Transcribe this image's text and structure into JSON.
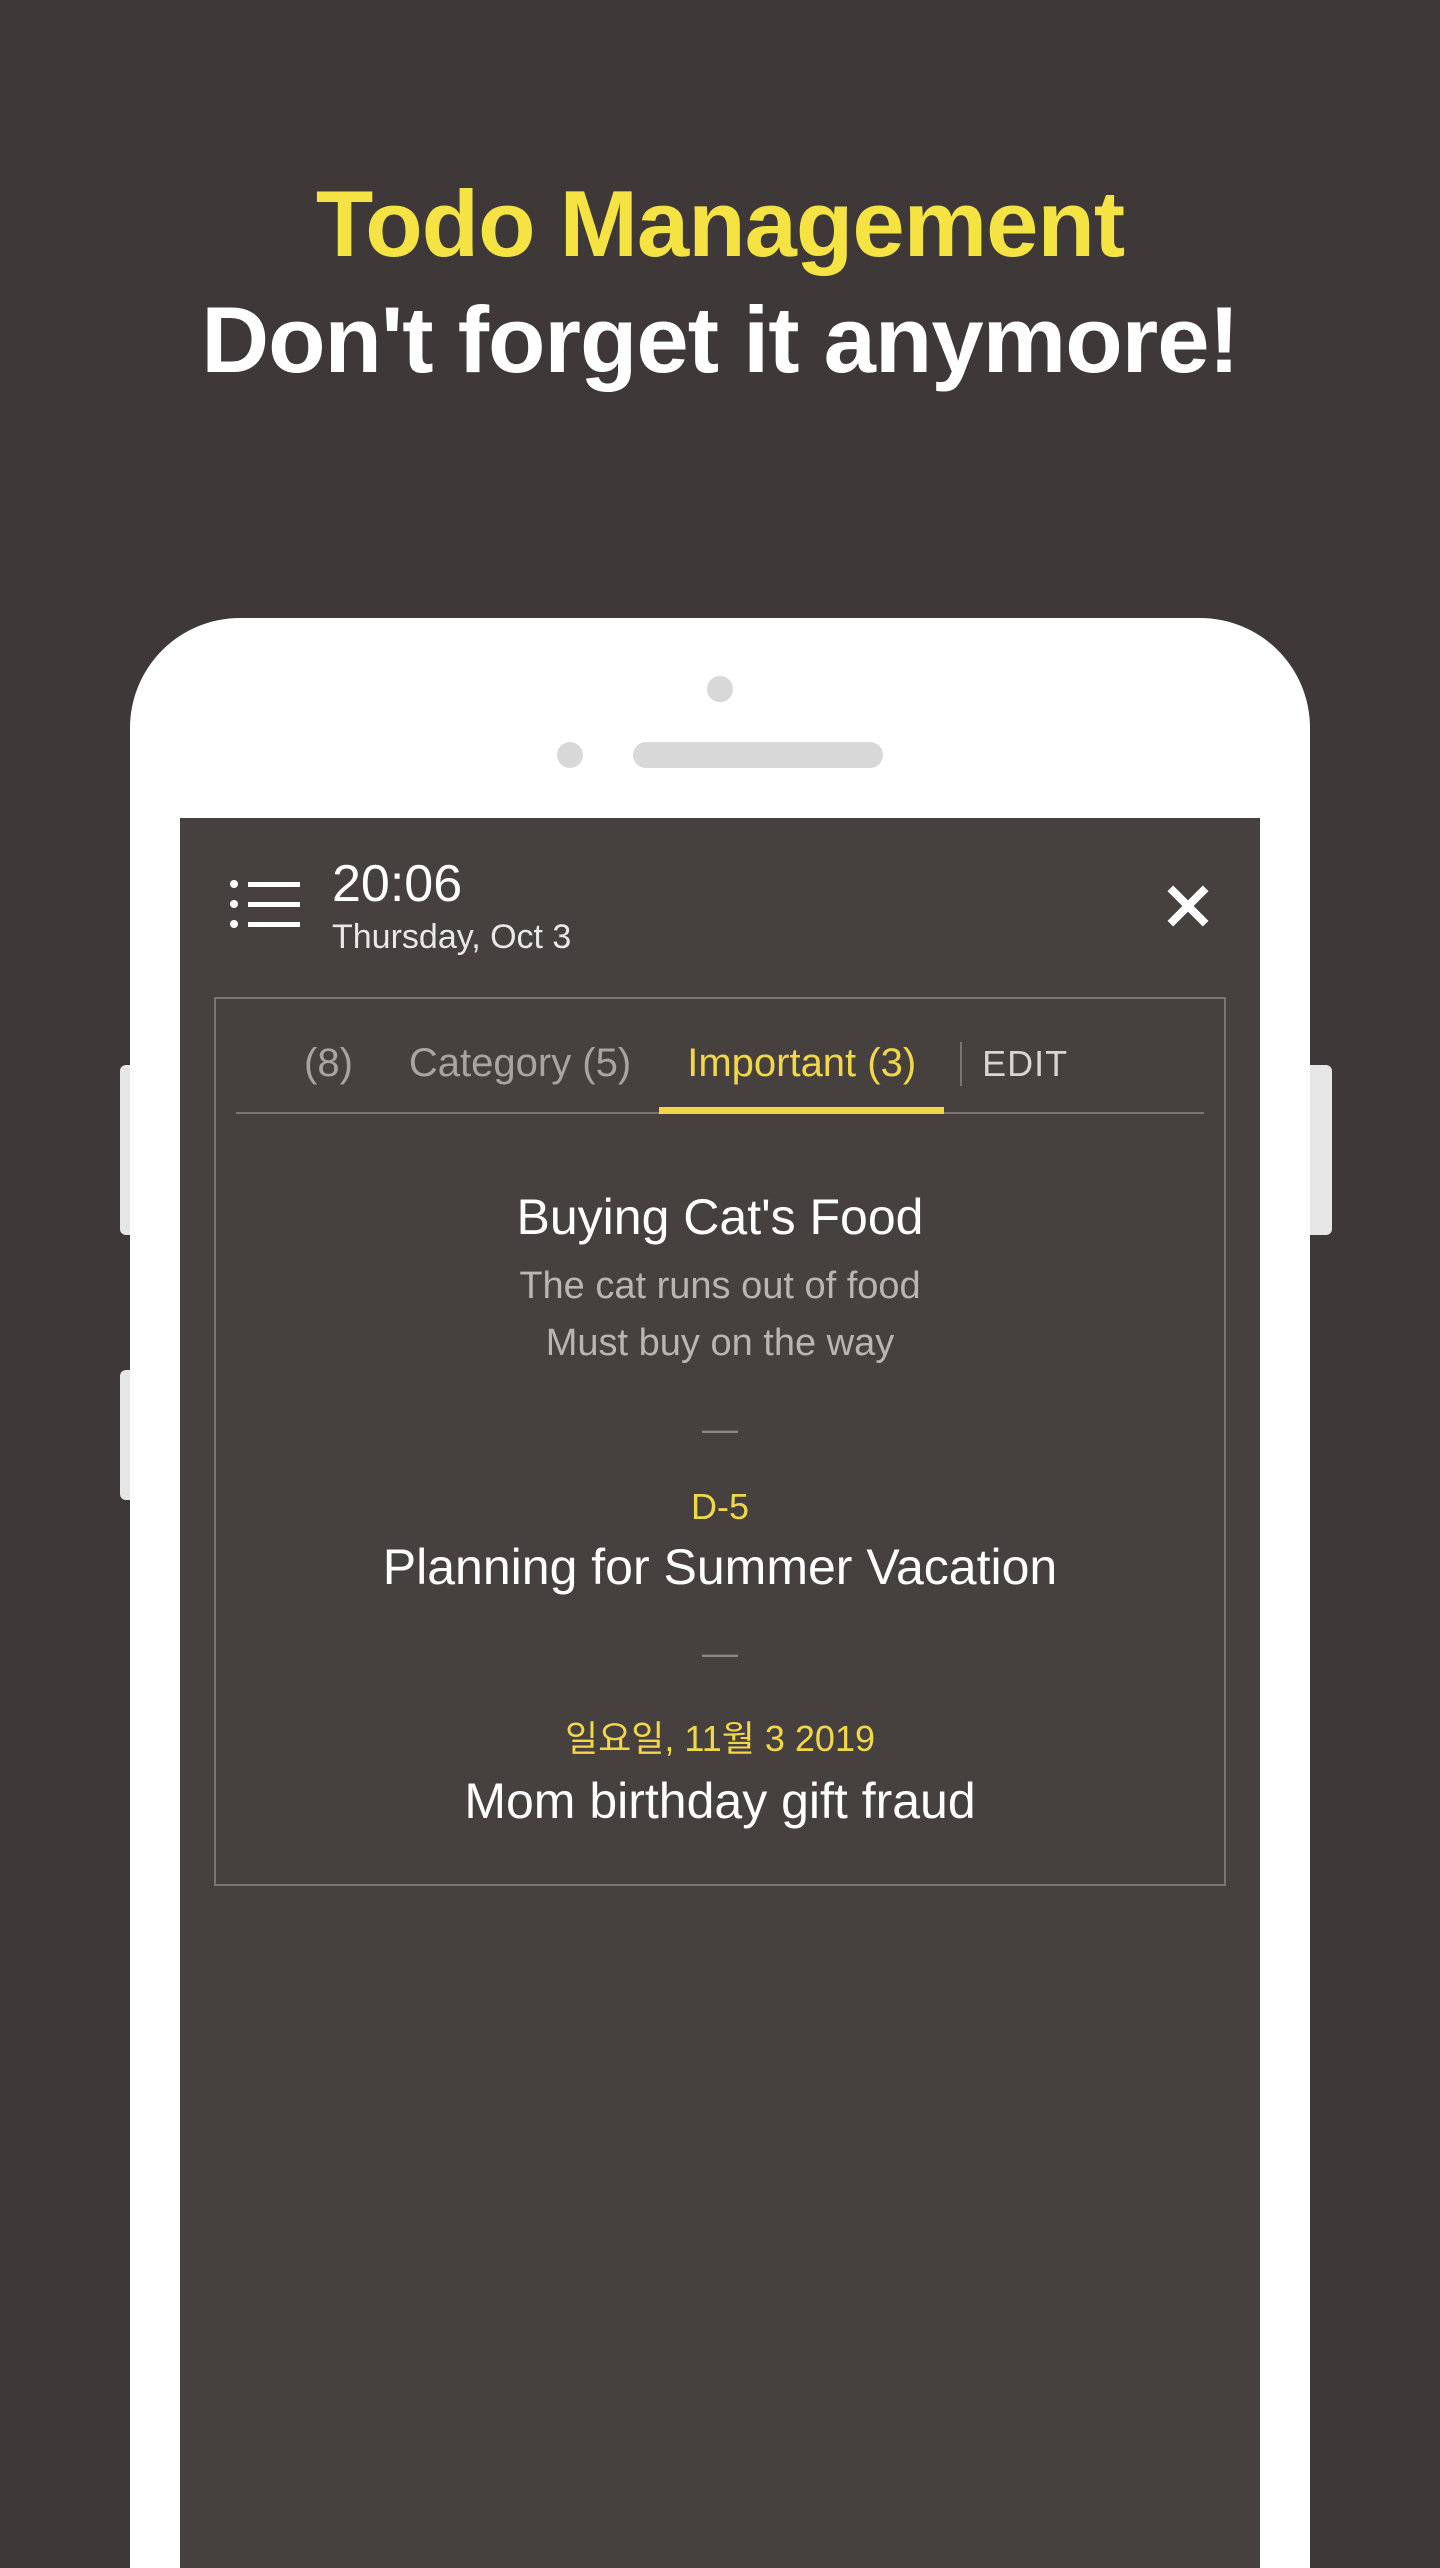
{
  "marketing": {
    "title": "Todo Management",
    "subtitle": "Don't forget it anymore!"
  },
  "header": {
    "time": "20:06",
    "date": "Thursday, Oct 3"
  },
  "tabs": {
    "all": "(8)",
    "category": "Category (5)",
    "important": "Important (3)",
    "edit": "EDIT"
  },
  "todos": [
    {
      "title": "Buying Cat's Food",
      "desc": "The cat runs out of food\nMust buy on the way"
    },
    {
      "badge": "D-5",
      "title": "Planning for Summer Vacation"
    },
    {
      "date": "일요일, 11월 3 2019",
      "title": "Mom birthday gift fraud"
    }
  ],
  "divider": "—"
}
